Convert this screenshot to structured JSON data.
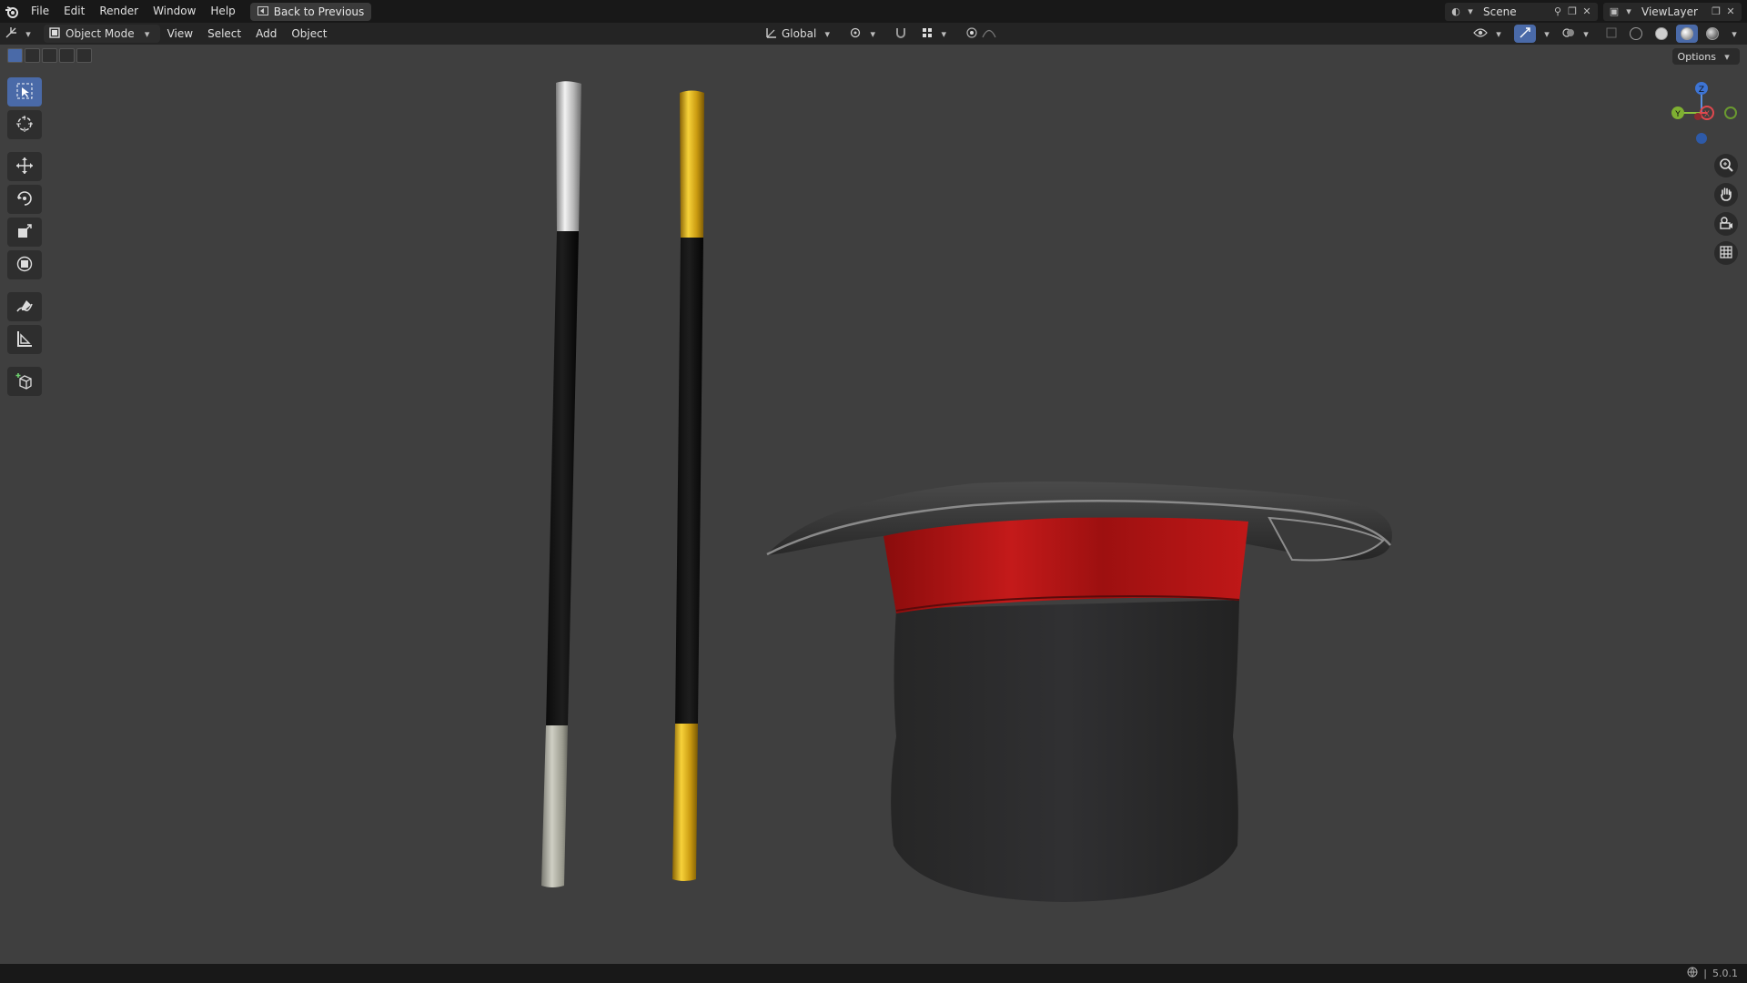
{
  "topbar": {
    "menus": [
      "File",
      "Edit",
      "Render",
      "Window",
      "Help"
    ],
    "back_label": "Back to Previous",
    "scene_name": "Scene",
    "view_layer": "ViewLayer"
  },
  "header": {
    "mode": "Object Mode",
    "menus": [
      "View",
      "Select",
      "Add",
      "Object"
    ],
    "transform_orientation": "Global"
  },
  "viewport": {
    "options_label": "Options",
    "gizmo_axes": [
      "Z",
      "Y",
      "X"
    ],
    "toolbar_icons": [
      "select-box-icon",
      "cursor-icon",
      "move-icon",
      "rotate-icon",
      "scale-icon",
      "transform-icon",
      "annotate-icon",
      "measure-icon",
      "add-cube-icon"
    ],
    "nav_icons": [
      "zoom-icon",
      "pan-hand-icon",
      "camera-view-icon",
      "ortho-grid-icon"
    ],
    "colors": {
      "background": "#3f3f3f",
      "accent": "#4a6aa8",
      "hat_band": "#b01515",
      "hat_body": "#2b2b2b",
      "wand_silver": "#c8c8c8",
      "wand_gold": "#d4a214"
    }
  },
  "statusbar": {
    "version": "5.0.1"
  }
}
